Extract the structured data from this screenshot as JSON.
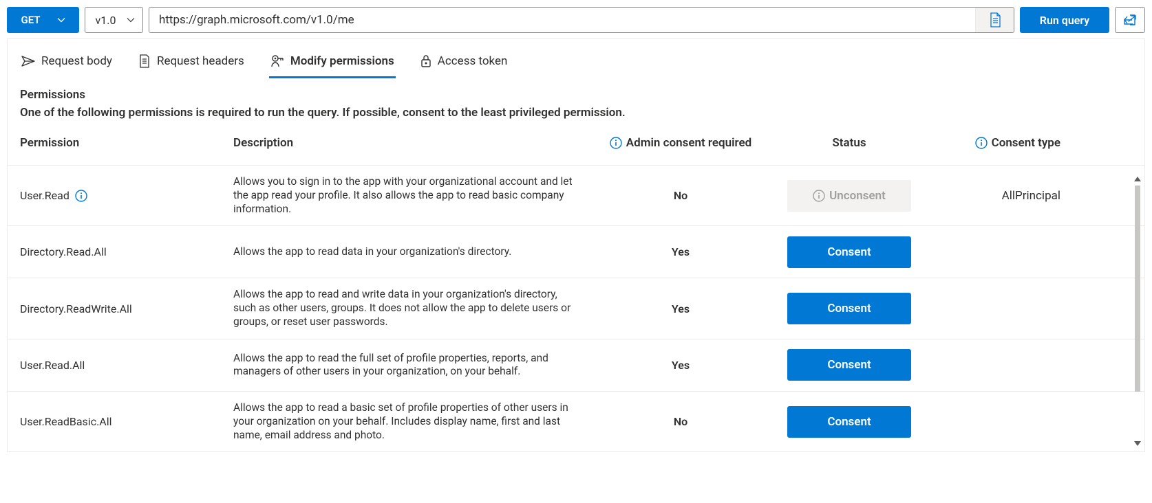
{
  "toolbar": {
    "method": "GET",
    "version": "v1.0",
    "url": "https://graph.microsoft.com/v1.0/me",
    "run_label": "Run query"
  },
  "tabs": {
    "request_body": "Request body",
    "request_headers": "Request headers",
    "modify_permissions": "Modify permissions",
    "access_token": "Access token"
  },
  "section": {
    "title": "Permissions",
    "description": "One of the following permissions is required to run the query. If possible, consent to the least privileged permission."
  },
  "columns": {
    "permission": "Permission",
    "description": "Description",
    "admin_consent": "Admin consent required",
    "status": "Status",
    "consent_type": "Consent type"
  },
  "buttons": {
    "consent": "Consent",
    "unconsent": "Unconsent"
  },
  "rows": [
    {
      "name": "User.Read",
      "has_info": true,
      "description": "Allows you to sign in to the app with your organizational account and let the app read your profile. It also allows the app to read basic company information.",
      "admin": "No",
      "status": "unconsent",
      "consent_type": "AllPrincipal"
    },
    {
      "name": "Directory.Read.All",
      "has_info": false,
      "description": "Allows the app to read data in your organization's directory.",
      "admin": "Yes",
      "status": "consent",
      "consent_type": ""
    },
    {
      "name": "Directory.ReadWrite.All",
      "has_info": false,
      "description": "Allows the app to read and write data in your organization's directory, such as other users, groups. It does not allow the app to delete users or groups, or reset user passwords.",
      "admin": "Yes",
      "status": "consent",
      "consent_type": ""
    },
    {
      "name": "User.Read.All",
      "has_info": false,
      "description": "Allows the app to read the full set of profile properties, reports, and managers of other users in your organization, on your behalf.",
      "admin": "Yes",
      "status": "consent",
      "consent_type": ""
    },
    {
      "name": "User.ReadBasic.All",
      "has_info": false,
      "description": "Allows the app to read a basic set of profile properties of other users in your organization on your behalf. Includes display name, first and last name, email address and photo.",
      "admin": "No",
      "status": "consent",
      "consent_type": ""
    }
  ]
}
